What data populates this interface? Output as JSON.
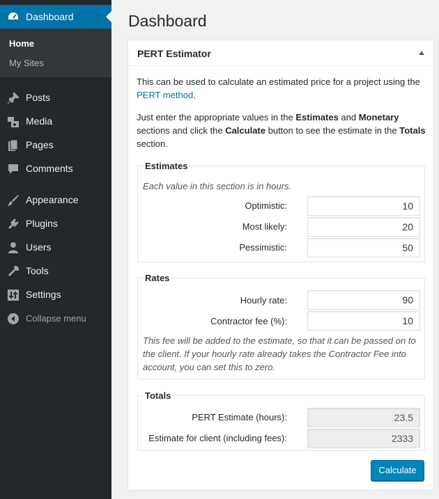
{
  "sidebar": {
    "dashboard_label": "Dashboard",
    "submenu": [
      {
        "label": "Home",
        "current": true
      },
      {
        "label": "My Sites",
        "current": false
      }
    ],
    "menu": [
      {
        "label": "Posts",
        "icon": "pin-icon"
      },
      {
        "label": "Media",
        "icon": "media-icon"
      },
      {
        "label": "Pages",
        "icon": "pages-icon"
      },
      {
        "label": "Comments",
        "icon": "comments-icon"
      },
      {
        "label": "Appearance",
        "icon": "brush-icon"
      },
      {
        "label": "Plugins",
        "icon": "plugin-icon"
      },
      {
        "label": "Users",
        "icon": "user-icon"
      },
      {
        "label": "Tools",
        "icon": "wrench-icon"
      },
      {
        "label": "Settings",
        "icon": "settings-icon"
      }
    ],
    "collapse_label": "Collapse menu"
  },
  "page": {
    "title": "Dashboard"
  },
  "widget": {
    "title": "PERT Estimator",
    "intro1_text": "This can be used to calculate an estimated price for a project using the ",
    "intro1_link": "PERT method",
    "intro1_end": ".",
    "intro2_a": "Just enter the appropriate values in the ",
    "intro2_b": "Estimates",
    "intro2_c": " and ",
    "intro2_d": "Monetary",
    "intro2_e": " sections and click the ",
    "intro2_f": "Calculate",
    "intro2_g": " button to see the estimate in the ",
    "intro2_h": "Totals",
    "intro2_i": " section.",
    "estimates": {
      "legend": "Estimates",
      "note": "Each value in this section is in hours.",
      "optimistic_label": "Optimistic:",
      "optimistic_value": "10",
      "likely_label": "Most likely:",
      "likely_value": "20",
      "pessimistic_label": "Pessimistic:",
      "pessimistic_value": "50"
    },
    "rates": {
      "legend": "Rates",
      "hourly_label": "Hourly rate:",
      "hourly_value": "90",
      "fee_label": "Contractor fee (%):",
      "fee_value": "10",
      "note": "This fee will be added to the estimate, so that it can be passed on to the client. If your hourly rate already takes the Contractor Fee into account, you can set this to zero."
    },
    "totals": {
      "legend": "Totals",
      "pert_label": "PERT Estimate (hours):",
      "pert_value": "23.5",
      "client_label": "Estimate for client (including fees):",
      "client_value": "2333"
    },
    "calculate_label": "Calculate"
  },
  "colors": {
    "sidebar_bg": "#23282d",
    "submenu_bg": "#32373c",
    "accent": "#0073aa",
    "button": "#0085ba"
  }
}
